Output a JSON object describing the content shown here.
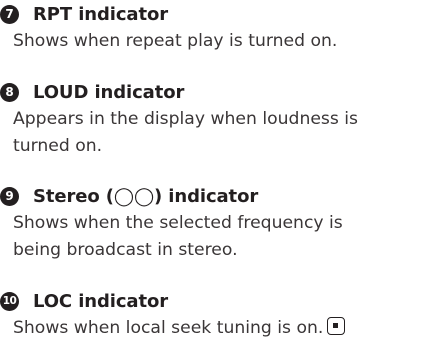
{
  "items": [
    {
      "number": "7",
      "title": "RPT indicator",
      "description": [
        "Shows when repeat play is turned on."
      ]
    },
    {
      "number": "8",
      "title": "LOUD indicator",
      "description": [
        "Appears in the display when loudness is",
        "turned on."
      ]
    },
    {
      "number": "9",
      "title": "Stereo (◯◯) indicator",
      "description": [
        "Shows when the selected frequency is",
        "being broadcast in stereo."
      ]
    },
    {
      "number": "10",
      "title": "LOC indicator",
      "description": [
        "Shows when local seek tuning is on."
      ]
    }
  ],
  "end_mark_icon": "end-of-section-icon"
}
